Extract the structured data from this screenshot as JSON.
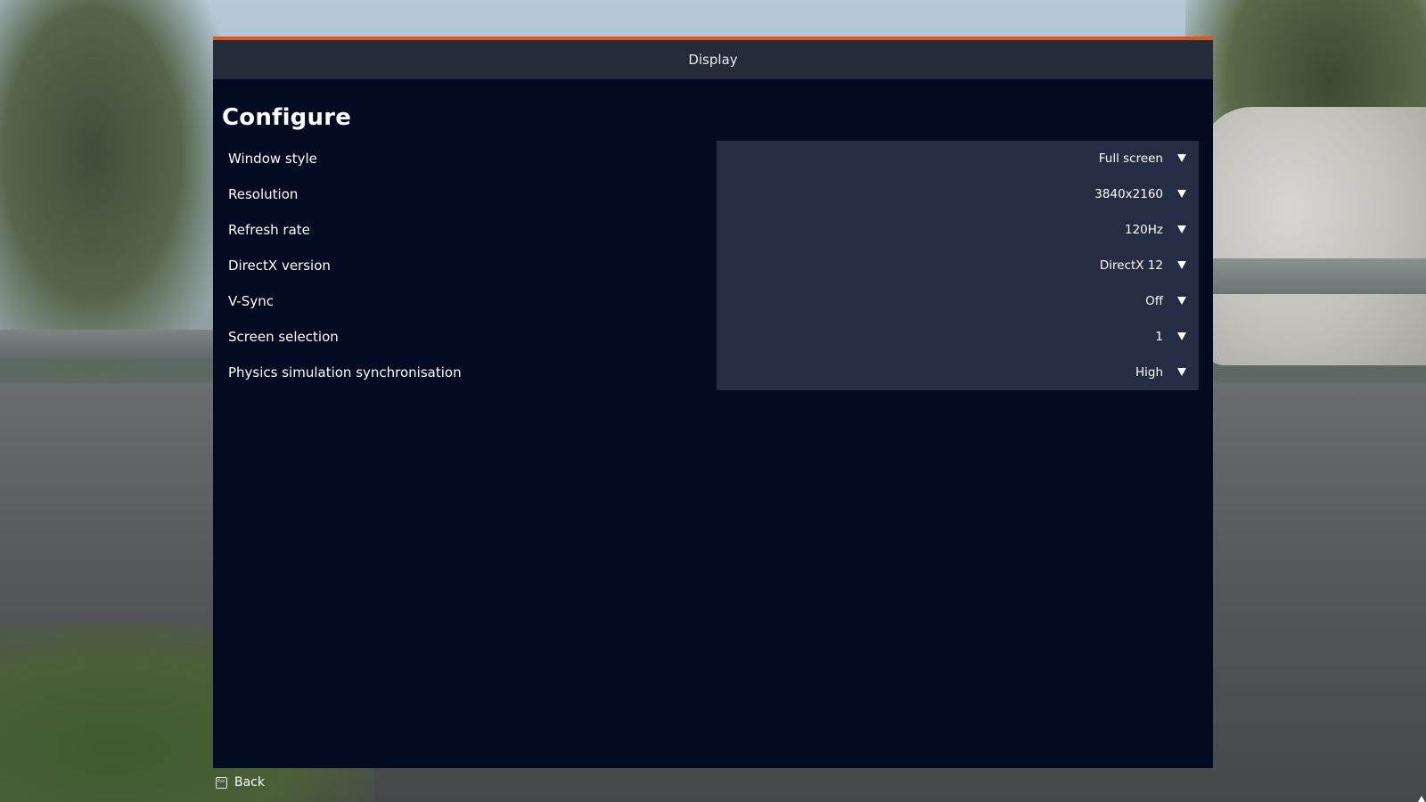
{
  "header": {
    "title": "Display"
  },
  "section": {
    "title": "Configure"
  },
  "settings": [
    {
      "label": "Window style",
      "value": "Full screen"
    },
    {
      "label": "Resolution",
      "value": "3840x2160"
    },
    {
      "label": "Refresh rate",
      "value": "120Hz"
    },
    {
      "label": "DirectX version",
      "value": "DirectX 12"
    },
    {
      "label": "V-Sync",
      "value": "Off"
    },
    {
      "label": "Screen selection",
      "value": "1"
    },
    {
      "label": "Physics simulation synchronisation",
      "value": "High"
    }
  ],
  "footer": {
    "key_hint": "Esc",
    "back_label": "Back"
  },
  "colors": {
    "accent": "#e2541f",
    "panel_bg": "#020b22",
    "header_bg": "#252c39",
    "select_bg": "#242d43"
  },
  "icons": {
    "dropdown": "chevron-down-icon",
    "back_key": "esc-key-icon"
  }
}
